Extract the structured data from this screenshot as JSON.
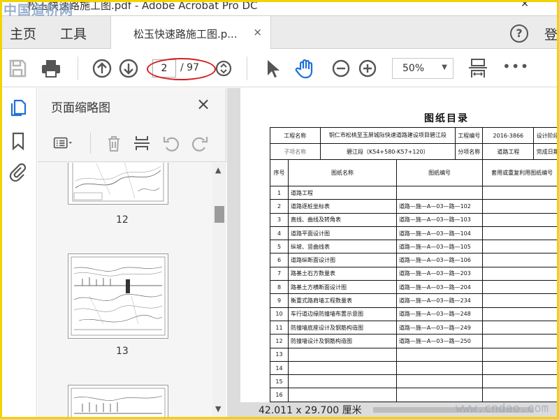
{
  "window": {
    "watermark": "中国道桥网",
    "title": "松玉快速路施工图.pdf - Adobe Acrobat Pro DC",
    "close_glyph": "✕"
  },
  "menu": {
    "home": "主页",
    "tools": "工具",
    "doc_tab": "松玉快速路施工图.p...",
    "doc_tab_close": "×",
    "help": "?",
    "signin": "登"
  },
  "toolbar": {
    "current_page": "2",
    "total_pages": "/ 97",
    "zoom": "50%",
    "more": "•••",
    "highlight_color": "#d41e1e"
  },
  "thumb_panel": {
    "title": "页面缩略图",
    "close": "×",
    "thumbnails": [
      {
        "label": "12"
      },
      {
        "label": "13"
      },
      {
        "label": ""
      }
    ]
  },
  "document": {
    "title": "图纸目录",
    "dimensions": "42.011 x 29.700 厘米",
    "header": {
      "project_name_label": "工程名称",
      "project_name": "铜仁市松桃至玉屏城际快速道路建设项目碧江段",
      "project_no_label": "工程编号",
      "project_no": "2016-3866",
      "design_stage_label": "设计阶段",
      "sub_project_label": "子项名称",
      "sub_project": "碧江段（K54+580-K57+120）",
      "item_name_label": "分项名称",
      "item_name": "道路工程",
      "completion_label": "完成日期"
    },
    "columns": [
      "序号",
      "图纸名称",
      "图纸编号",
      "套用或重复利用图纸编号"
    ],
    "rows": [
      {
        "no": "1",
        "name": "道路工程",
        "code": ""
      },
      {
        "no": "2",
        "name": "道路逐桩坐标表",
        "code": "道路—施—A—03—路—102"
      },
      {
        "no": "3",
        "name": "直线、曲线及转角表",
        "code": "道路—施—A—03—路—103"
      },
      {
        "no": "4",
        "name": "道路平面设计图",
        "code": "道路—施—A—03—路—104"
      },
      {
        "no": "5",
        "name": "纵坡、竖曲线表",
        "code": "道路—施—A—03—路—105"
      },
      {
        "no": "6",
        "name": "道路纵断面设计图",
        "code": "道路—施—A—03—路—106"
      },
      {
        "no": "7",
        "name": "路基土石方数量表",
        "code": "道路—施—A—03—路—203"
      },
      {
        "no": "8",
        "name": "路基土方横断面设计图",
        "code": "道路—施—A—03—路—204"
      },
      {
        "no": "9",
        "name": "衡重式路肩墙工程数量表",
        "code": "道路—施—A—03—路—234"
      },
      {
        "no": "10",
        "name": "车行道边缘防撞墙布置示意图",
        "code": "道路—施—A—03—路—248"
      },
      {
        "no": "11",
        "name": "防撞墙底座设计及钢筋构造图",
        "code": "道路—施—A—03—路—249"
      },
      {
        "no": "12",
        "name": "防撞墙设计及钢筋构造图",
        "code": "道路—施—A—03—路—250"
      },
      {
        "no": "13",
        "name": "",
        "code": ""
      },
      {
        "no": "14",
        "name": "",
        "code": ""
      },
      {
        "no": "15",
        "name": "",
        "code": ""
      },
      {
        "no": "16",
        "name": "",
        "code": ""
      }
    ]
  },
  "watermark_bottom": "www.cndao.com"
}
